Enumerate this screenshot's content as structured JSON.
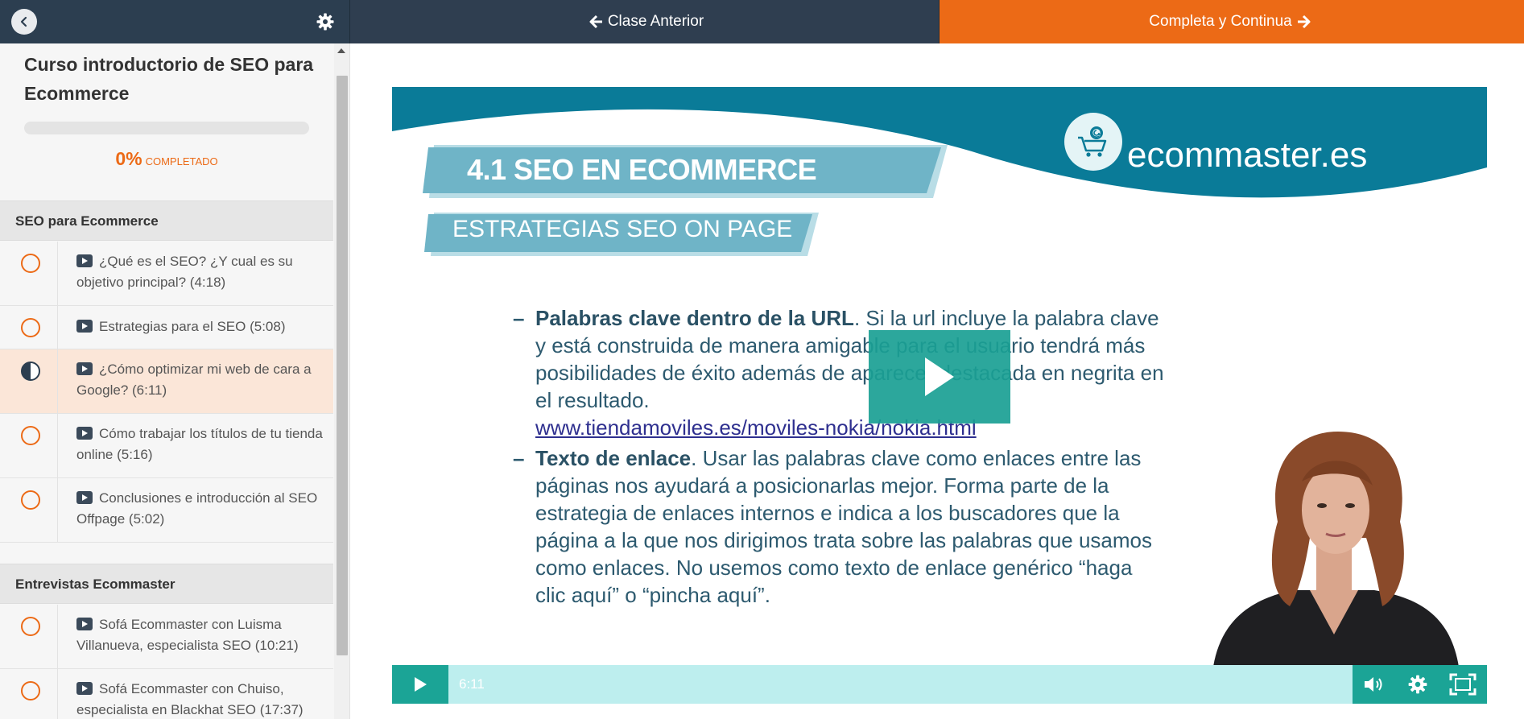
{
  "topbar": {
    "prev_label": "Clase Anterior",
    "next_label": "Completa y Continua"
  },
  "course": {
    "title": "Curso introductorio de SEO para Ecommerce",
    "progress_pct": "0%",
    "progress_value": 0,
    "progress_label": "COMPLETADO"
  },
  "sections": [
    {
      "title": "SEO para Ecommerce",
      "lessons": [
        {
          "label": "¿Qué es el SEO? ¿Y cual es su objetivo principal? (4:18)",
          "status": "not-started"
        },
        {
          "label": "Estrategias para el SEO (5:08)",
          "status": "not-started"
        },
        {
          "label": "¿Cómo optimizar mi web de cara a Google? (6:11)",
          "status": "in-progress"
        },
        {
          "label": "Cómo trabajar los títulos de tu tienda online (5:16)",
          "status": "not-started"
        },
        {
          "label": "Conclusiones e introducción al SEO Offpage (5:02)",
          "status": "not-started"
        }
      ]
    },
    {
      "title": "Entrevistas Ecommaster",
      "lessons": [
        {
          "label": "Sofá Ecommaster con Luisma Villanueva, especialista SEO (10:21)",
          "status": "not-started"
        },
        {
          "label": "Sofá Ecommaster con Chuiso, especialista en Blackhat SEO (17:37)",
          "status": "not-started"
        }
      ]
    }
  ],
  "video": {
    "slide_number_title": "4.1 SEO EN ECOMMERCE",
    "slide_subtitle": "ESTRATEGIAS SEO ON PAGE",
    "brand": "ecommaster.es",
    "bullet1_bold": "Palabras clave dentro de la URL",
    "bullet1_text": ". Si la url incluye la palabra clave y está construida de manera amigable para el usuario tendrá más posibilidades de éxito además de aparecer destacada en negrita en el resultado.",
    "bullet1_link": "www.tiendamoviles.es/moviles-nokia/nokia.html",
    "bullet2_bold": "Texto de enlace",
    "bullet2_text": ". Usar las palabras clave como enlaces entre las páginas nos ayudará a posicionarlas mejor. Forma parte de la estrategia de enlaces internos e indica a los buscadores que la página a la que nos dirigimos trata sobre las palabras que usamos como enlaces. No usemos como texto de enlace genérico “haga clic aquí” o “pincha aquí”.",
    "duration": "6:11"
  },
  "icons": {
    "back": "chevron-left-icon",
    "settings": "gear-icon",
    "prev": "arrow-left-icon",
    "next": "arrow-right-icon",
    "video_lesson": "video-play-icon"
  },
  "colors": {
    "accent": "#ec6a16",
    "topbar": "#2c3e50",
    "video_teal": "#1ba496",
    "slide_teal": "#0a7b98"
  }
}
